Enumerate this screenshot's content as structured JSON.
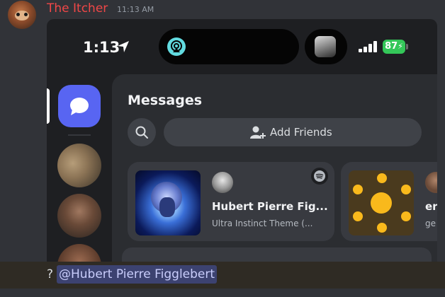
{
  "message": {
    "author": "The Itcher",
    "timestamp": "11:13 AM",
    "question_mark": "?",
    "mention": "@Hubert Pierre Figglebert",
    "author_color": "#f04747",
    "mention_color": "#c9cdfb"
  },
  "phone_status": {
    "time": "1:13",
    "battery": "87"
  },
  "app": {
    "section_title": "Messages",
    "add_friends_label": "Add Friends",
    "accent_color": "#5865f2"
  },
  "activity_cards": [
    {
      "name": "Hubert Pierre Fig...",
      "activity": "Ultra Instinct Theme (...",
      "icon": "spotify-icon"
    },
    {
      "name": "er",
      "activity": "ge"
    }
  ]
}
